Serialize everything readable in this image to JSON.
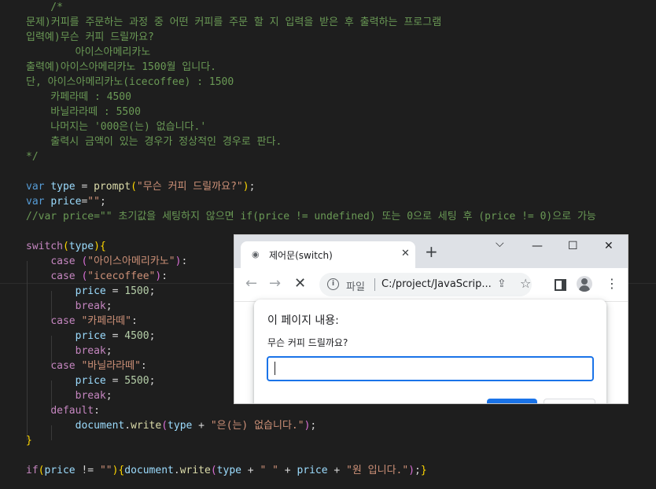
{
  "editor": {
    "lines": [
      [
        {
          "t": "    /*",
          "c": "cm"
        }
      ],
      [
        {
          "t": "문제)커피를 주문하는 과정 중 어떤 커피를 주문 할 지 입력을 받은 후 출력하는 프로그램",
          "c": "cm"
        }
      ],
      [
        {
          "t": "입력예)무슨 커피 드릴까요?",
          "c": "cm"
        }
      ],
      [
        {
          "t": "        아이스아메리카노",
          "c": "cm"
        }
      ],
      [
        {
          "t": "출력예)아이스아메리카노 1500월 입니다.",
          "c": "cm"
        }
      ],
      [
        {
          "t": "단, 아이스아메리카노(icecoffee) : 1500",
          "c": "cm"
        }
      ],
      [
        {
          "t": "    카페라떼 : 4500",
          "c": "cm"
        }
      ],
      [
        {
          "t": "    바닐라라떼 : 5500",
          "c": "cm"
        }
      ],
      [
        {
          "t": "    나머지는 '000은(는) 없습니다.'",
          "c": "cm"
        }
      ],
      [
        {
          "t": "    출력시 금액이 있는 경우가 정상적인 경우로 판다.",
          "c": "cm"
        }
      ],
      [
        {
          "t": "*/",
          "c": "cm"
        }
      ],
      [],
      [
        {
          "t": "var",
          "c": "kw"
        },
        {
          "t": " ",
          "c": "op"
        },
        {
          "t": "type",
          "c": "vr"
        },
        {
          "t": " = ",
          "c": "op"
        },
        {
          "t": "prompt",
          "c": "fn"
        },
        {
          "t": "(",
          "c": "br1"
        },
        {
          "t": "\"무슨 커피 드릴까요?\"",
          "c": "st"
        },
        {
          "t": ")",
          "c": "br1"
        },
        {
          "t": ";",
          "c": "op"
        }
      ],
      [
        {
          "t": "var",
          "c": "kw"
        },
        {
          "t": " ",
          "c": "op"
        },
        {
          "t": "price",
          "c": "vr"
        },
        {
          "t": "=",
          "c": "op"
        },
        {
          "t": "\"\"",
          "c": "st"
        },
        {
          "t": ";",
          "c": "op"
        }
      ],
      [
        {
          "t": "//var price=\"\" 초기값을 세팅하지 않으면 if(price != undefined) 또는 0으로 세팅 후 (price != 0)으로 가능",
          "c": "cm"
        }
      ],
      [],
      [
        {
          "t": "switch",
          "c": "ctrl"
        },
        {
          "t": "(",
          "c": "br1"
        },
        {
          "t": "type",
          "c": "vr"
        },
        {
          "t": ")",
          "c": "br1"
        },
        {
          "t": "{",
          "c": "br1"
        }
      ],
      [
        {
          "t": "    ",
          "c": "op"
        },
        {
          "t": "case",
          "c": "ctrl"
        },
        {
          "t": " ",
          "c": "op"
        },
        {
          "t": "(",
          "c": "br2"
        },
        {
          "t": "\"아이스아메리카노\"",
          "c": "st"
        },
        {
          "t": ")",
          "c": "br2"
        },
        {
          "t": ":",
          "c": "op"
        }
      ],
      [
        {
          "t": "    ",
          "c": "op"
        },
        {
          "t": "case",
          "c": "ctrl"
        },
        {
          "t": " ",
          "c": "op"
        },
        {
          "t": "(",
          "c": "br2"
        },
        {
          "t": "\"icecoffee\"",
          "c": "st"
        },
        {
          "t": ")",
          "c": "br2"
        },
        {
          "t": ":",
          "c": "op"
        }
      ],
      [
        {
          "t": "        ",
          "c": "op"
        },
        {
          "t": "price",
          "c": "vr"
        },
        {
          "t": " = ",
          "c": "op"
        },
        {
          "t": "1500",
          "c": "nm"
        },
        {
          "t": ";",
          "c": "op"
        }
      ],
      [
        {
          "t": "        ",
          "c": "op"
        },
        {
          "t": "break",
          "c": "ctrl"
        },
        {
          "t": ";",
          "c": "op"
        }
      ],
      [
        {
          "t": "    ",
          "c": "op"
        },
        {
          "t": "case",
          "c": "ctrl"
        },
        {
          "t": " ",
          "c": "op"
        },
        {
          "t": "\"카페라떼\"",
          "c": "st"
        },
        {
          "t": ":",
          "c": "op"
        }
      ],
      [
        {
          "t": "        ",
          "c": "op"
        },
        {
          "t": "price",
          "c": "vr"
        },
        {
          "t": " = ",
          "c": "op"
        },
        {
          "t": "4500",
          "c": "nm"
        },
        {
          "t": ";",
          "c": "op"
        }
      ],
      [
        {
          "t": "        ",
          "c": "op"
        },
        {
          "t": "break",
          "c": "ctrl"
        },
        {
          "t": ";",
          "c": "op"
        }
      ],
      [
        {
          "t": "    ",
          "c": "op"
        },
        {
          "t": "case",
          "c": "ctrl"
        },
        {
          "t": " ",
          "c": "op"
        },
        {
          "t": "\"바닐라라떼\"",
          "c": "st"
        },
        {
          "t": ":",
          "c": "op"
        }
      ],
      [
        {
          "t": "        ",
          "c": "op"
        },
        {
          "t": "price",
          "c": "vr"
        },
        {
          "t": " = ",
          "c": "op"
        },
        {
          "t": "5500",
          "c": "nm"
        },
        {
          "t": ";",
          "c": "op"
        }
      ],
      [
        {
          "t": "        ",
          "c": "op"
        },
        {
          "t": "break",
          "c": "ctrl"
        },
        {
          "t": ";",
          "c": "op"
        }
      ],
      [
        {
          "t": "    ",
          "c": "op"
        },
        {
          "t": "default",
          "c": "ctrl"
        },
        {
          "t": ":",
          "c": "op"
        }
      ],
      [
        {
          "t": "        ",
          "c": "op"
        },
        {
          "t": "document",
          "c": "vr"
        },
        {
          "t": ".",
          "c": "op"
        },
        {
          "t": "write",
          "c": "fn"
        },
        {
          "t": "(",
          "c": "br2"
        },
        {
          "t": "type",
          "c": "vr"
        },
        {
          "t": " + ",
          "c": "op"
        },
        {
          "t": "\"은(는) 없습니다.\"",
          "c": "st"
        },
        {
          "t": ")",
          "c": "br2"
        },
        {
          "t": ";",
          "c": "op"
        }
      ],
      [
        {
          "t": "}",
          "c": "br1"
        }
      ],
      [],
      [
        {
          "t": "if",
          "c": "ctrl"
        },
        {
          "t": "(",
          "c": "br1"
        },
        {
          "t": "price",
          "c": "vr"
        },
        {
          "t": " != ",
          "c": "op"
        },
        {
          "t": "\"\"",
          "c": "st"
        },
        {
          "t": ")",
          "c": "br1"
        },
        {
          "t": "{",
          "c": "br1"
        },
        {
          "t": "document",
          "c": "vr"
        },
        {
          "t": ".",
          "c": "op"
        },
        {
          "t": "write",
          "c": "fn"
        },
        {
          "t": "(",
          "c": "br2"
        },
        {
          "t": "type",
          "c": "vr"
        },
        {
          "t": " + ",
          "c": "op"
        },
        {
          "t": "\" \"",
          "c": "st"
        },
        {
          "t": " + ",
          "c": "op"
        },
        {
          "t": "price",
          "c": "vr"
        },
        {
          "t": " + ",
          "c": "op"
        },
        {
          "t": "\"원 입니다.\"",
          "c": "st"
        },
        {
          "t": ")",
          "c": "br2"
        },
        {
          "t": ";",
          "c": "op"
        },
        {
          "t": "}",
          "c": "br1"
        }
      ]
    ]
  },
  "browser": {
    "tab": {
      "favicon": "globe-icon",
      "title": "제어문(switch)",
      "close_glyph": "✕"
    },
    "new_tab_glyph": "+",
    "window": {
      "dropdown_glyph": "⌵",
      "minimize_glyph": "—",
      "maximize_glyph": "☐",
      "close_glyph": "✕"
    },
    "nav": {
      "back_glyph": "←",
      "forward_glyph": "→",
      "stop_glyph": "✕"
    },
    "omnibox": {
      "info_glyph": "i",
      "scheme_label": "파일",
      "url": "C:/project/JavaScrip..."
    },
    "share_glyph": "⇪",
    "star_glyph": "☆",
    "menu_glyph": "⋮"
  },
  "dialog": {
    "title": "이 페이지 내용:",
    "message": "무슨 커피 드릴까요?",
    "input_value": ""
  },
  "colors": {
    "editor_bg": "#1e1e1e",
    "comment": "#6a9955",
    "keyword": "#569cd6",
    "control": "#c586c0",
    "variable": "#9cdcfe",
    "function": "#dcdcaa",
    "string": "#ce9178",
    "number": "#b5cea8",
    "accent": "#1a73e8"
  }
}
